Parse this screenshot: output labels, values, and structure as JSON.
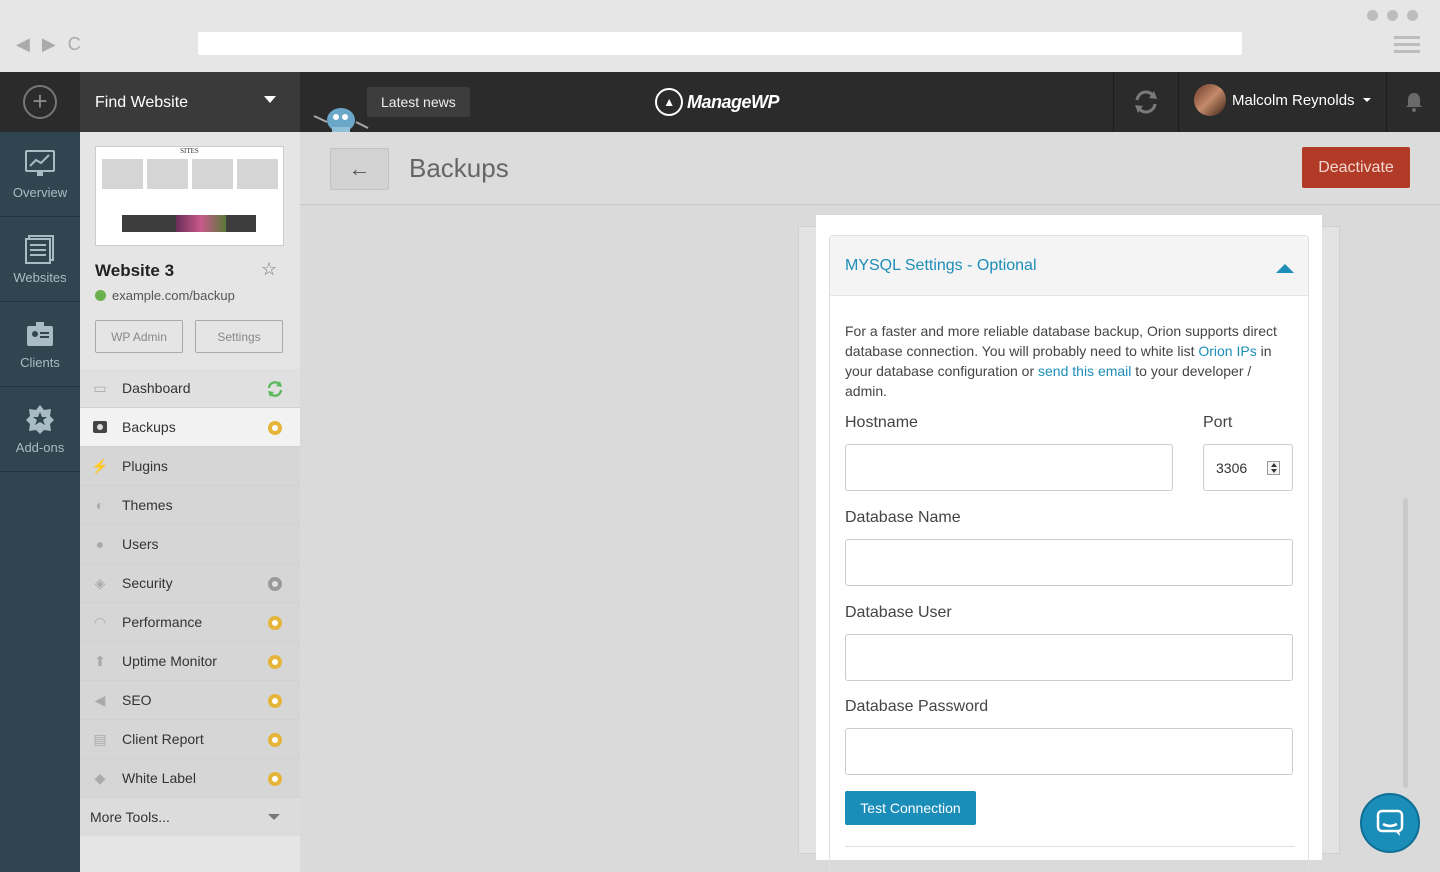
{
  "browser": {
    "nav_back": "◀",
    "nav_forward": "▶",
    "nav_reload": "C"
  },
  "topbar": {
    "find_website": "Find Website",
    "latest_news": "Latest news",
    "logo_text": "ManageWP",
    "user_name": "Malcolm Reynolds"
  },
  "rail": {
    "items": [
      {
        "label": "Overview",
        "icon": "overview-chart-icon"
      },
      {
        "label": "Websites",
        "icon": "websites-icon"
      },
      {
        "label": "Clients",
        "icon": "clients-icon"
      },
      {
        "label": "Add-ons",
        "icon": "addons-star-icon"
      }
    ]
  },
  "site": {
    "thumb_heading": "SITES",
    "title": "Website 3",
    "url": "example.com/backup",
    "wp_admin": "WP Admin",
    "settings": "Settings"
  },
  "menu": {
    "items": [
      {
        "label": "Dashboard",
        "icon": "monitor-icon",
        "badge": "refresh"
      },
      {
        "label": "Backups",
        "icon": "backup-icon",
        "badge": "gear-gold"
      },
      {
        "label": "Plugins",
        "icon": "plug-icon",
        "badge": ""
      },
      {
        "label": "Themes",
        "icon": "palette-icon",
        "badge": ""
      },
      {
        "label": "Users",
        "icon": "user-icon",
        "badge": ""
      },
      {
        "label": "Security",
        "icon": "shield-icon",
        "badge": "gear-gray"
      },
      {
        "label": "Performance",
        "icon": "gauge-icon",
        "badge": "gear-gold"
      },
      {
        "label": "Uptime Monitor",
        "icon": "arrow-up-icon",
        "badge": "gear-gold"
      },
      {
        "label": "SEO",
        "icon": "megaphone-icon",
        "badge": "gear-gold"
      },
      {
        "label": "Client Report",
        "icon": "report-icon",
        "badge": "gear-gold"
      },
      {
        "label": "White Label",
        "icon": "tag-icon",
        "badge": "gear-gold"
      }
    ],
    "more": "More Tools..."
  },
  "page": {
    "title": "Backups",
    "deactivate": "Deactivate"
  },
  "mysql": {
    "section_title": "MYSQL Settings - Optional",
    "desc_1": "For a faster and more reliable database backup, Orion supports direct database connection. You will probably need to white list ",
    "link_ips": "Orion IPs",
    "desc_2": " in your database configuration or ",
    "link_email": "send this email",
    "desc_3": " to your developer / admin.",
    "hostname_label": "Hostname",
    "hostname_value": "",
    "port_label": "Port",
    "port_value": "3306",
    "dbname_label": "Database Name",
    "dbname_value": "",
    "dbuser_label": "Database User",
    "dbuser_value": "",
    "dbpass_label": "Database Password",
    "dbpass_value": "",
    "test_connection": "Test Connection"
  },
  "colors": {
    "accent": "#1a8db8",
    "danger": "#b13b26",
    "rail_bg": "#2f4651",
    "topbar_bg": "#2b2b2b",
    "gear_gold": "#e5b53a"
  }
}
